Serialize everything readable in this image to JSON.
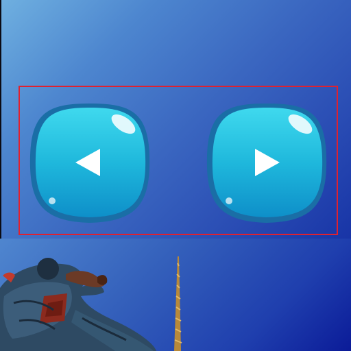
{
  "scene": {
    "background_top": "#6fb0e0",
    "background_bottom": "#0d1f98",
    "highlight_color": "#e0212f"
  },
  "controls": {
    "prev_button": {
      "icon": "triangle-left-icon",
      "color": "#1fb4d8"
    },
    "next_button": {
      "icon": "triangle-right-icon",
      "color": "#1fb4d8"
    }
  },
  "artwork": {
    "character": "ninja-character",
    "prop": "golden-rope"
  }
}
